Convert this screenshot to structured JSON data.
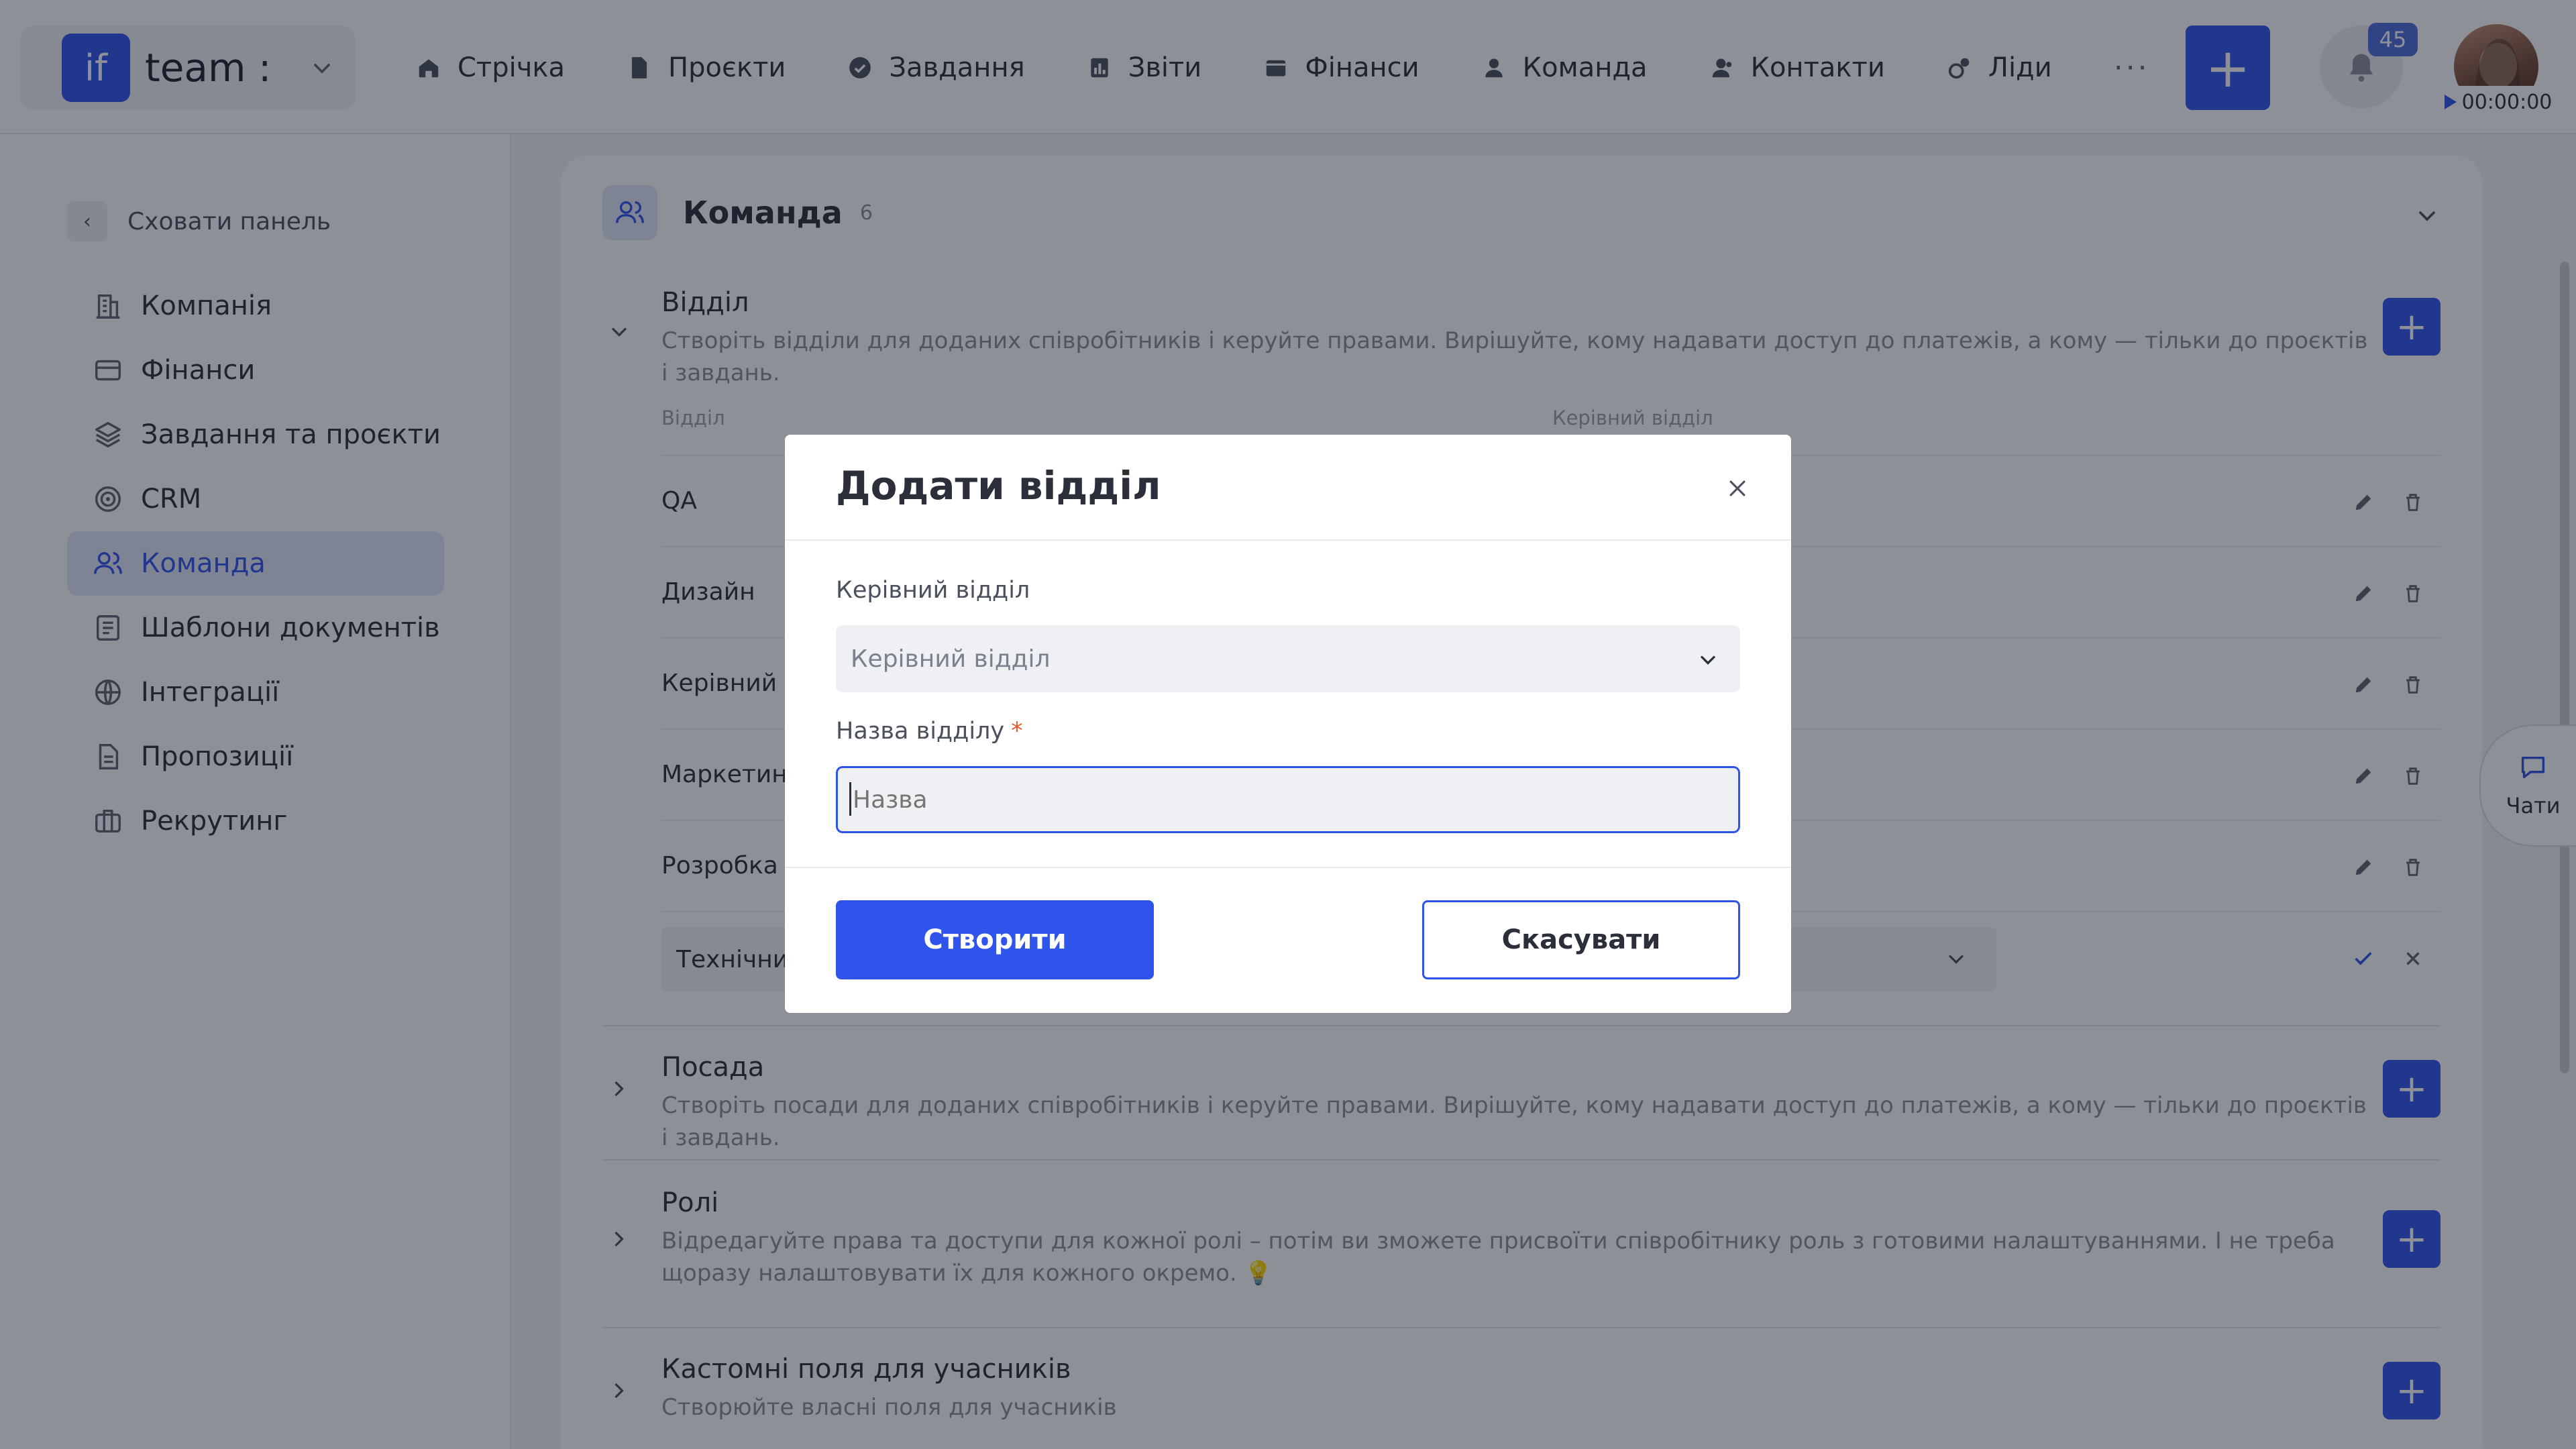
{
  "workspace": {
    "logo_text": "if",
    "name": "team :"
  },
  "nav": [
    {
      "label": "Стрічка",
      "icon": "home-icon"
    },
    {
      "label": "Проєкти",
      "icon": "document-icon"
    },
    {
      "label": "Завдання",
      "icon": "check-circle-icon"
    },
    {
      "label": "Звіти",
      "icon": "report-icon"
    },
    {
      "label": "Фінанси",
      "icon": "wallet-icon"
    },
    {
      "label": "Команда",
      "icon": "user-icon"
    },
    {
      "label": "Контакти",
      "icon": "contacts-icon"
    },
    {
      "label": "Ліди",
      "icon": "leads-icon"
    }
  ],
  "header": {
    "more": "···",
    "add": "+",
    "notifications_count": "45",
    "timer": "00:00:00"
  },
  "sidebar": {
    "hide_label": "Сховати панель",
    "items": [
      {
        "label": "Компанія",
        "icon": "company-icon"
      },
      {
        "label": "Фінанси",
        "icon": "card-icon"
      },
      {
        "label": "Завдання та проєкти",
        "icon": "layers-icon"
      },
      {
        "label": "CRM",
        "icon": "target-icon"
      },
      {
        "label": "Команда",
        "icon": "team-icon",
        "active": true
      },
      {
        "label": "Шаблони документів",
        "icon": "template-icon"
      },
      {
        "label": "Інтеграції",
        "icon": "globe-icon"
      },
      {
        "label": "Пропозиції",
        "icon": "proposal-icon"
      },
      {
        "label": "Рекрутинг",
        "icon": "briefcase-icon"
      }
    ]
  },
  "main": {
    "title": "Команда",
    "count": "6",
    "department": {
      "title": "Відділ",
      "description": "Створіть відділи для доданих співробітників і керуйте правами. Вирішуйте, кому надавати доступ до платежів, а кому — тільки до проєктів і завдань.",
      "col_department": "Відділ",
      "col_parent": "Керівний відділ",
      "rows": [
        "QA",
        "Дизайн",
        "Керівний в",
        "Маркетинг",
        "Розробка"
      ],
      "editing_value": "Технічний"
    },
    "sections": [
      {
        "title": "Посада",
        "description": "Створіть посади для доданих співробітників і керуйте правами. Вирішуйте, кому надавати доступ до платежів, а кому — тільки до проєктів і завдань."
      },
      {
        "title": "Ролі",
        "description": "Відредагуйте права та доступи для кожної ролі – потім ви зможете присвоїти співробітнику роль з готовими налаштуваннями. І не треба щоразу налаштовувати їх для кожного окремо. 💡"
      },
      {
        "title": "Кастомні поля для учасників",
        "description": "Створюйте власні поля для учасників"
      }
    ]
  },
  "chat": {
    "label": "Чати"
  },
  "modal": {
    "title": "Додати відділ",
    "parent_label": "Керівний відділ",
    "parent_placeholder": "Керівний відділ",
    "name_label": "Назва відділу",
    "required_mark": "*",
    "name_placeholder": "Назва",
    "create_label": "Створити",
    "cancel_label": "Скасувати"
  },
  "colors": {
    "accent": "#2f54eb",
    "overlay": "rgba(18,24,38,0.48)",
    "required": "#e8562a"
  }
}
